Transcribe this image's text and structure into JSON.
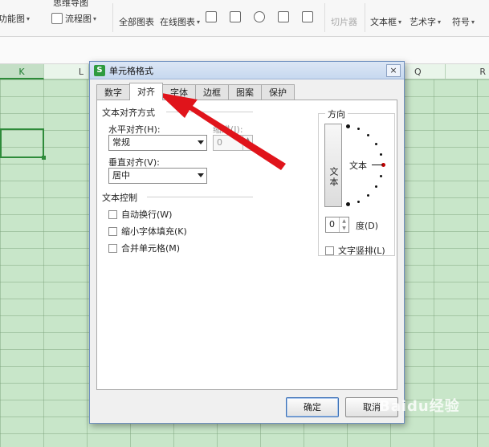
{
  "ribbon": {
    "items": [
      {
        "label": "功能图",
        "id": "function-chart"
      },
      {
        "label": "流程图",
        "id": "flowchart"
      },
      {
        "label": "全部图表",
        "id": "all-charts"
      },
      {
        "label": "在线图表",
        "id": "online-charts"
      },
      {
        "label": "切片器",
        "id": "slicer"
      },
      {
        "label": "文本框",
        "id": "textbox"
      },
      {
        "label": "艺术字",
        "id": "wordart"
      },
      {
        "label": "符号",
        "id": "symbol"
      }
    ],
    "partial_top": "思维导图"
  },
  "columns": [
    {
      "label": "K"
    },
    {
      "label": "L"
    },
    {
      "label": "Q"
    },
    {
      "label": "R"
    }
  ],
  "dialog": {
    "title": "单元格格式",
    "app_icon": "S",
    "close": "×",
    "tabs": [
      "数字",
      "对齐",
      "字体",
      "边框",
      "图案",
      "保护"
    ],
    "active_tab": "对齐",
    "text_align": {
      "group_title": "文本对齐方式",
      "horizontal_label": "水平对齐(H):",
      "horizontal_value": "常规",
      "indent_label": "缩进(I):",
      "indent_value": "0",
      "vertical_label": "垂直对齐(V):",
      "vertical_value": "居中"
    },
    "text_control": {
      "group_title": "文本控制",
      "wrap": "自动换行(W)",
      "shrink": "缩小字体填充(K)",
      "merge": "合并单元格(M)"
    },
    "orientation": {
      "group_title": "方向",
      "vertical_text": "文本",
      "dial_text": "文本",
      "degree_value": "0",
      "degree_label": "度(D)",
      "stack_label": "文字竖排(L)"
    },
    "ok": "确定",
    "cancel": "取消"
  },
  "watermark": "Baidu经验",
  "colors": {
    "grid": "#c8e6c9",
    "accent_green": "#2e8b3a",
    "arrow_red": "#e0141b"
  }
}
